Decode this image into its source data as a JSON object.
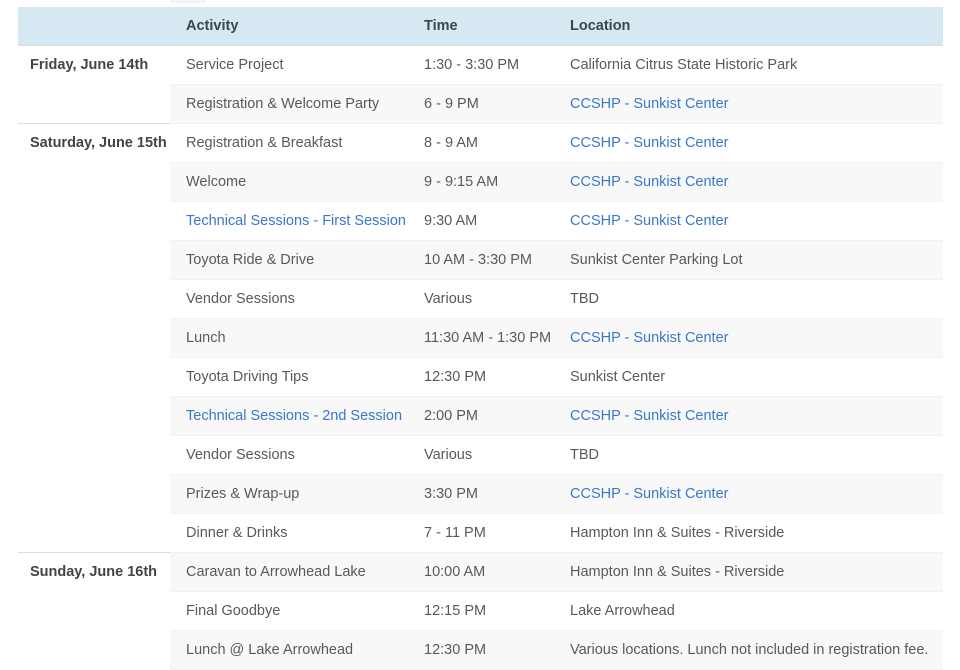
{
  "table": {
    "columns": [
      {
        "key": "date",
        "label": ""
      },
      {
        "key": "activity",
        "label": "Activity"
      },
      {
        "key": "time",
        "label": "Time"
      },
      {
        "key": "location",
        "label": "Location"
      }
    ],
    "header_background": "#d6e9f2",
    "link_color": "#3a78c8",
    "stripe_color": "#f8f8f8",
    "groups": [
      {
        "date": "Friday, June 14th",
        "rows": [
          {
            "activity": "Service Project",
            "activity_link": false,
            "time": "1:30 - 3:30 PM",
            "location": "California Citrus State Historic Park",
            "location_link": false
          },
          {
            "activity": "Registration & Welcome Party",
            "activity_link": false,
            "time": "6 - 9 PM",
            "location": "CCSHP - Sunkist Center",
            "location_link": true
          }
        ]
      },
      {
        "date": "Saturday, June 15th",
        "rows": [
          {
            "activity": "Registration & Breakfast",
            "activity_link": false,
            "time": "8 - 9 AM",
            "location": "CCSHP - Sunkist Center",
            "location_link": true
          },
          {
            "activity": "Welcome",
            "activity_link": false,
            "time": "9 - 9:15 AM",
            "location": "CCSHP - Sunkist Center",
            "location_link": true
          },
          {
            "activity": "Technical Sessions - First Session",
            "activity_link": true,
            "time": "9:30 AM",
            "location": "CCSHP - Sunkist Center",
            "location_link": true
          },
          {
            "activity": "Toyota Ride & Drive",
            "activity_link": false,
            "time": "10 AM - 3:30 PM",
            "location": "Sunkist Center Parking Lot",
            "location_link": false
          },
          {
            "activity": "Vendor Sessions",
            "activity_link": false,
            "time": "Various",
            "location": "TBD",
            "location_link": false
          },
          {
            "activity": "Lunch",
            "activity_link": false,
            "time": "11:30 AM - 1:30 PM",
            "location": "CCSHP - Sunkist Center",
            "location_link": true
          },
          {
            "activity": "Toyota Driving Tips",
            "activity_link": false,
            "time": "12:30 PM",
            "location": "Sunkist Center",
            "location_link": false
          },
          {
            "activity": "Technical Sessions - 2nd Session",
            "activity_link": true,
            "time": "2:00 PM",
            "location": "CCSHP - Sunkist Center",
            "location_link": true
          },
          {
            "activity": "Vendor Sessions",
            "activity_link": false,
            "time": "Various",
            "location": "TBD",
            "location_link": false
          },
          {
            "activity": "Prizes & Wrap-up",
            "activity_link": false,
            "time": "3:30 PM",
            "location": "CCSHP - Sunkist Center",
            "location_link": true
          },
          {
            "activity": "Dinner & Drinks",
            "activity_link": false,
            "time": "7 - 11 PM",
            "location": "Hampton Inn & Suites - Riverside",
            "location_link": false
          }
        ]
      },
      {
        "date": "Sunday, June 16th",
        "rows": [
          {
            "activity": "Caravan to Arrowhead Lake",
            "activity_link": false,
            "time": "10:00 AM",
            "location": "Hampton Inn & Suites - Riverside",
            "location_link": false
          },
          {
            "activity": "Final Goodbye",
            "activity_link": false,
            "time": "12:15 PM",
            "location": "Lake Arrowhead",
            "location_link": false
          },
          {
            "activity": "Lunch @ Lake Arrowhead",
            "activity_link": false,
            "time": "12:30 PM",
            "location": "Various locations. Lunch not included in registration fee.",
            "location_link": false
          }
        ]
      }
    ]
  }
}
